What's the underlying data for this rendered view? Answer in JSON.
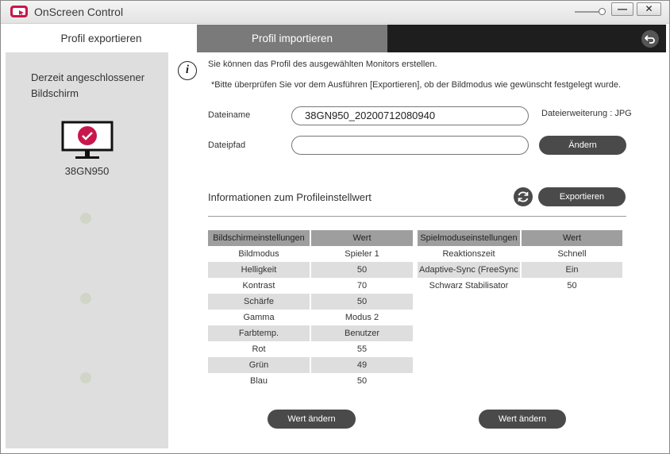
{
  "window": {
    "title": "OnScreen Control",
    "minimize_label": "—",
    "close_label": "✕"
  },
  "tabs": [
    {
      "label": "Profil exportieren"
    },
    {
      "label": "Profil importieren"
    }
  ],
  "sidebar": {
    "title": "Derzeit angeschlossener Bildschirm",
    "monitor_name": "38GN950"
  },
  "info": {
    "line1": "Sie können das Profil des ausgewählten Monitors erstellen.",
    "line2": "*Bitte überprüfen Sie vor dem Ausführen [Exportieren], ob der Bildmodus wie gewünscht festgelegt wurde."
  },
  "form": {
    "filename_label": "Dateiname",
    "filename_value": "38GN950_20200712080940",
    "extension_label": "Dateierweiterung : JPG",
    "path_label": "Dateipfad",
    "path_value": "",
    "change_label": "Ändern"
  },
  "profile": {
    "section_title": "Informationen zum Profileinstellwert",
    "export_label": "Exportieren"
  },
  "screen_table": {
    "headers": [
      "Bildschirmeinstellungen",
      "Wert"
    ],
    "rows": [
      [
        "Bildmodus",
        "Spieler 1"
      ],
      [
        "Helligkeit",
        "50"
      ],
      [
        "Kontrast",
        "70"
      ],
      [
        "Schärfe",
        "50"
      ],
      [
        "Gamma",
        "Modus 2"
      ],
      [
        "Farbtemp.",
        "Benutzer"
      ],
      [
        "Rot",
        "55"
      ],
      [
        "Grün",
        "49"
      ],
      [
        "Blau",
        "50"
      ]
    ]
  },
  "game_table": {
    "headers": [
      "Spielmoduseinstellungen",
      "Wert"
    ],
    "rows": [
      [
        "Reaktionszeit",
        "Schnell"
      ],
      [
        "Adaptive-Sync (FreeSync / G-Sync)",
        "Ein"
      ],
      [
        "Schwarz Stabilisator",
        "50"
      ]
    ]
  },
  "buttons": {
    "change_value_left": "Wert ändern",
    "change_value_right": "Wert ändern"
  },
  "colors": {
    "tab_active": "#ffffff",
    "tab_inactive": "#7a7a7a",
    "tab_bar": "#1e1e1e",
    "accent_red": "#c8174b",
    "button_dark": "#4a4a4a"
  }
}
